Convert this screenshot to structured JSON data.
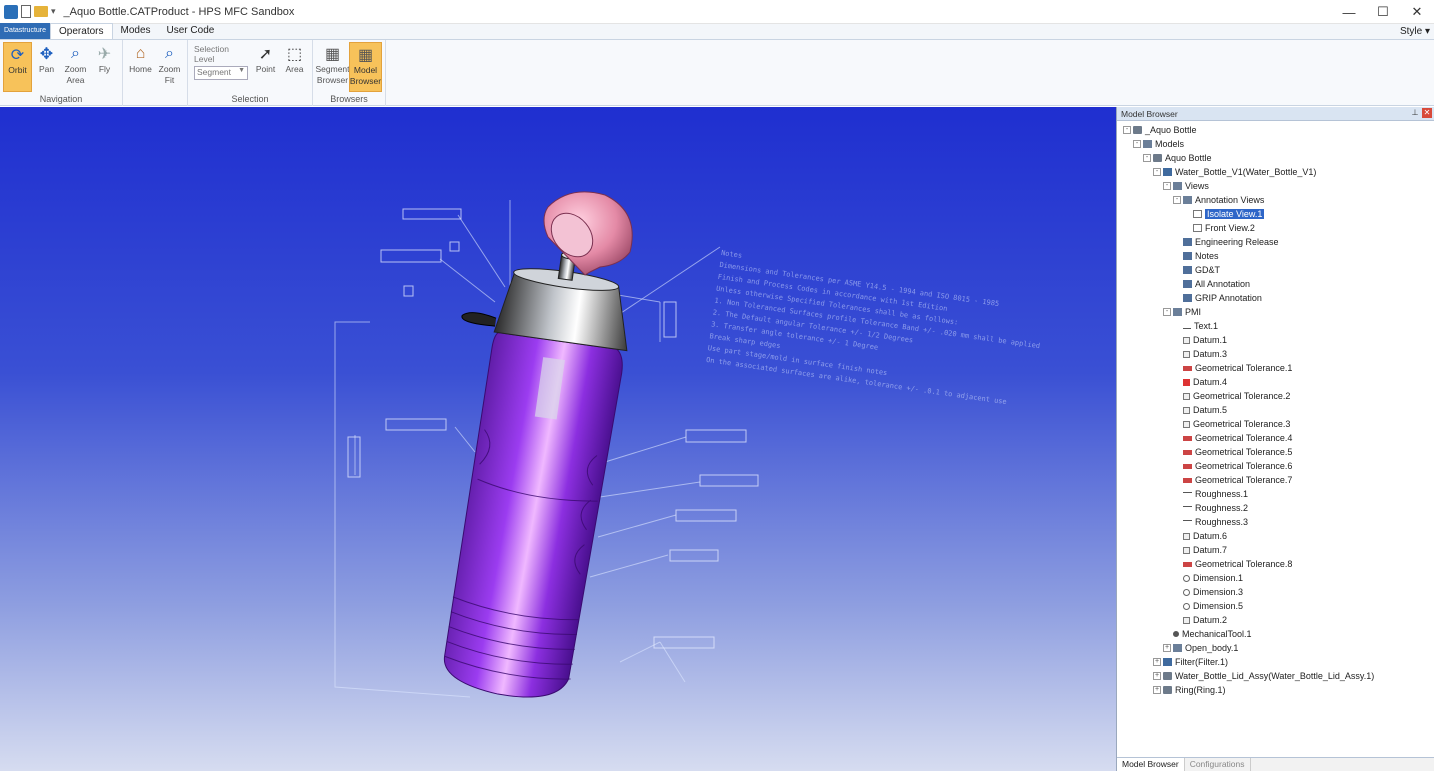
{
  "window": {
    "title": "_Aquo Bottle.CATProduct - HPS MFC Sandbox",
    "controls": [
      "—",
      "☐",
      "✕"
    ]
  },
  "tabs": {
    "file_label": "Datastructure",
    "items": [
      {
        "label": "Operators",
        "active": true
      },
      {
        "label": "Modes",
        "active": false
      },
      {
        "label": "User Code",
        "active": false
      }
    ],
    "style_label": "Style"
  },
  "ribbon": {
    "navigation": {
      "label": "Navigation",
      "buttons": [
        {
          "label": "Orbit",
          "icon": "orbit-icon",
          "selected": true
        },
        {
          "label": "Pan",
          "icon": "pan-icon",
          "selected": false
        },
        {
          "label": "Zoom Area",
          "icon": "zoom-area-icon",
          "selected": false
        },
        {
          "label": "Fly",
          "icon": "fly-icon",
          "selected": false
        }
      ]
    },
    "home": {
      "buttons": [
        {
          "label": "Home",
          "icon": "home-icon"
        },
        {
          "label": "Zoom Fit",
          "icon": "zoom-fit-icon"
        }
      ]
    },
    "selection": {
      "label": "Selection",
      "level_caption": "Selection Level",
      "level_value": "Segment",
      "buttons": [
        {
          "label": "Point",
          "icon": "point-select-icon"
        },
        {
          "label": "Area",
          "icon": "area-select-icon"
        }
      ]
    },
    "browsers": {
      "label": "Browsers",
      "buttons": [
        {
          "label": "Segment Browser",
          "icon": "segment-browser-icon",
          "selected": false
        },
        {
          "label": "Model Browser",
          "icon": "model-browser-icon",
          "selected": true
        }
      ]
    }
  },
  "viewport": {
    "notes": [
      "Notes",
      "Dimensions and Tolerances per ASME Y14.5 - 1994 and ISO 8015 - 1985",
      "Finish and Process Codes in accordance with 1st Edition",
      "Unless otherwise Specified Tolerances shall be as follows:",
      "1. Non Toleranced Surfaces profile Tolerance Band +/- .020 mm shall be applied",
      "2. The Default angular Tolerance +/- 1/2 Degrees",
      "3. Transfer angle tolerance +/- 1 Degree",
      "Break sharp edges",
      "Use part stage/mold in surface finish notes",
      "On the associated surfaces are alike, tolerance +/- .0.1 to adjacent use"
    ],
    "colors": {
      "bottle": "#8a2be2",
      "cap": "#e48aa6",
      "collar": "#9aa0a8"
    }
  },
  "panel": {
    "title": "Model Browser",
    "tabs": [
      {
        "label": "Model Browser",
        "active": true
      },
      {
        "label": "Configurations",
        "active": false
      }
    ],
    "tree": [
      {
        "label": "_Aquo Bottle",
        "level": 0,
        "exp": "-",
        "icon": "assembly-icon"
      },
      {
        "label": "Models",
        "level": 1,
        "exp": "-",
        "icon": "folder-icon"
      },
      {
        "label": "Aquo Bottle",
        "level": 2,
        "exp": "-",
        "icon": "assembly-icon"
      },
      {
        "label": "Water_Bottle_V1(Water_Bottle_V1)",
        "level": 3,
        "exp": "-",
        "icon": "part-icon"
      },
      {
        "label": "Views",
        "level": 4,
        "exp": "-",
        "icon": "folder-icon"
      },
      {
        "label": "Annotation Views",
        "level": 5,
        "exp": "-",
        "icon": "folder-icon"
      },
      {
        "label": "Isolate View.1",
        "level": 6,
        "exp": "",
        "icon": "view-icon",
        "selected": true
      },
      {
        "label": "Front View.2",
        "level": 6,
        "exp": "",
        "icon": "view-icon"
      },
      {
        "label": "Engineering Release",
        "level": 5,
        "exp": "",
        "icon": "note-icon"
      },
      {
        "label": "Notes",
        "level": 5,
        "exp": "",
        "icon": "note-icon"
      },
      {
        "label": "GD&T",
        "level": 5,
        "exp": "",
        "icon": "note-icon"
      },
      {
        "label": "All Annotation",
        "level": 5,
        "exp": "",
        "icon": "note-icon"
      },
      {
        "label": "GRIP Annotation",
        "level": 5,
        "exp": "",
        "icon": "note-icon"
      },
      {
        "label": "PMI",
        "level": 4,
        "exp": "-",
        "icon": "folder-icon"
      },
      {
        "label": "Text.1",
        "level": 5,
        "exp": "",
        "icon": "pmi-text-icon"
      },
      {
        "label": "Datum.1",
        "level": 5,
        "exp": "",
        "icon": "datum-icon"
      },
      {
        "label": "Datum.3",
        "level": 5,
        "exp": "",
        "icon": "datum-icon"
      },
      {
        "label": "Geometrical Tolerance.1",
        "level": 5,
        "exp": "",
        "icon": "tolerance-icon"
      },
      {
        "label": "Datum.4",
        "level": 5,
        "exp": "",
        "icon": "datum-red-icon"
      },
      {
        "label": "Geometrical Tolerance.2",
        "level": 5,
        "exp": "",
        "icon": "datum-icon"
      },
      {
        "label": "Datum.5",
        "level": 5,
        "exp": "",
        "icon": "datum-icon"
      },
      {
        "label": "Geometrical Tolerance.3",
        "level": 5,
        "exp": "",
        "icon": "datum-icon"
      },
      {
        "label": "Geometrical Tolerance.4",
        "level": 5,
        "exp": "",
        "icon": "tolerance-icon"
      },
      {
        "label": "Geometrical Tolerance.5",
        "level": 5,
        "exp": "",
        "icon": "tolerance-icon"
      },
      {
        "label": "Geometrical Tolerance.6",
        "level": 5,
        "exp": "",
        "icon": "tolerance-icon"
      },
      {
        "label": "Geometrical Tolerance.7",
        "level": 5,
        "exp": "",
        "icon": "tolerance-icon"
      },
      {
        "label": "Roughness.1",
        "level": 5,
        "exp": "",
        "icon": "roughness-icon"
      },
      {
        "label": "Roughness.2",
        "level": 5,
        "exp": "",
        "icon": "roughness-icon"
      },
      {
        "label": "Roughness.3",
        "level": 5,
        "exp": "",
        "icon": "roughness-icon"
      },
      {
        "label": "Datum.6",
        "level": 5,
        "exp": "",
        "icon": "datum-icon"
      },
      {
        "label": "Datum.7",
        "level": 5,
        "exp": "",
        "icon": "datum-icon"
      },
      {
        "label": "Geometrical Tolerance.8",
        "level": 5,
        "exp": "",
        "icon": "tolerance-icon"
      },
      {
        "label": "Dimension.1",
        "level": 5,
        "exp": "",
        "icon": "dimension-icon"
      },
      {
        "label": "Dimension.3",
        "level": 5,
        "exp": "",
        "icon": "dimension-icon"
      },
      {
        "label": "Dimension.5",
        "level": 5,
        "exp": "",
        "icon": "dimension-icon"
      },
      {
        "label": "Datum.2",
        "level": 5,
        "exp": "",
        "icon": "datum-icon"
      },
      {
        "label": "MechanicalTool.1",
        "level": 4,
        "exp": "",
        "icon": "tool-icon"
      },
      {
        "label": "Open_body.1",
        "level": 4,
        "exp": "+",
        "icon": "folder-icon"
      },
      {
        "label": "Filter(Filter.1)",
        "level": 3,
        "exp": "+",
        "icon": "part-icon"
      },
      {
        "label": "Water_Bottle_Lid_Assy(Water_Bottle_Lid_Assy.1)",
        "level": 3,
        "exp": "+",
        "icon": "assembly-icon"
      },
      {
        "label": "Ring(Ring.1)",
        "level": 3,
        "exp": "+",
        "icon": "assembly-icon"
      }
    ]
  }
}
